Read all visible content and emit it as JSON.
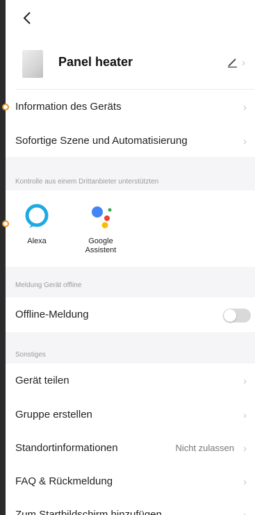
{
  "header": {
    "device_name": "Panel heater"
  },
  "menu": {
    "info": "Information des Geräts",
    "scene": "Sofortige Szene und Automatisierung"
  },
  "third_party": {
    "section_title": "Kontrolle aus einem Drittanbieter unterstützten",
    "alexa": "Alexa",
    "google_line1": "Google",
    "google_line2": "Assistent"
  },
  "offline": {
    "section_title": "Meldung Gerät offline",
    "label": "Offline-Meldung",
    "enabled": false
  },
  "misc": {
    "section_title": "Sonstiges",
    "share": "Gerät teilen",
    "group": "Gruppe erstellen",
    "location": "Standortinformationen",
    "location_value": "Nicht zulassen",
    "faq": "FAQ & Rückmeldung",
    "homescreen": "Zum Startbildschirm hinzufügen"
  },
  "colors": {
    "alexa": "#1fa9e1",
    "google_blue": "#4285f4",
    "google_red": "#ea4335",
    "google_yellow": "#fbbc05",
    "google_green": "#34a853",
    "marker": "#e8902b"
  }
}
